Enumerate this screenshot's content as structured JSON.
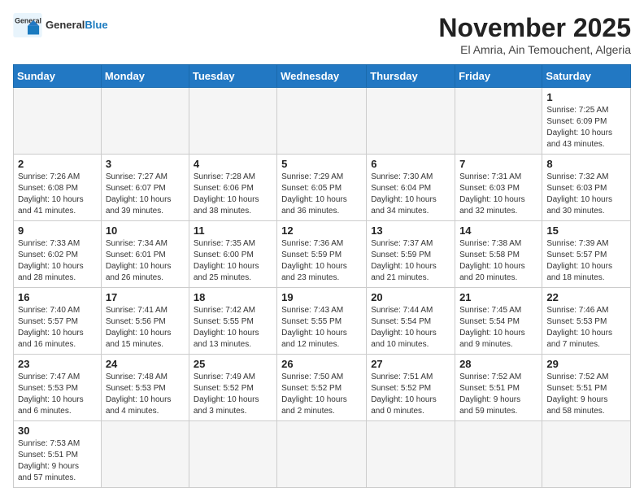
{
  "logo": {
    "text_general": "General",
    "text_blue": "Blue"
  },
  "title": {
    "month_year": "November 2025",
    "location": "El Amria, Ain Temouchent, Algeria"
  },
  "headers": [
    "Sunday",
    "Monday",
    "Tuesday",
    "Wednesday",
    "Thursday",
    "Friday",
    "Saturday"
  ],
  "days": [
    {
      "num": "",
      "info": ""
    },
    {
      "num": "",
      "info": ""
    },
    {
      "num": "",
      "info": ""
    },
    {
      "num": "",
      "info": ""
    },
    {
      "num": "",
      "info": ""
    },
    {
      "num": "",
      "info": ""
    },
    {
      "num": "1",
      "info": "Sunrise: 7:25 AM\nSunset: 6:09 PM\nDaylight: 10 hours\nand 43 minutes."
    },
    {
      "num": "2",
      "info": "Sunrise: 7:26 AM\nSunset: 6:08 PM\nDaylight: 10 hours\nand 41 minutes."
    },
    {
      "num": "3",
      "info": "Sunrise: 7:27 AM\nSunset: 6:07 PM\nDaylight: 10 hours\nand 39 minutes."
    },
    {
      "num": "4",
      "info": "Sunrise: 7:28 AM\nSunset: 6:06 PM\nDaylight: 10 hours\nand 38 minutes."
    },
    {
      "num": "5",
      "info": "Sunrise: 7:29 AM\nSunset: 6:05 PM\nDaylight: 10 hours\nand 36 minutes."
    },
    {
      "num": "6",
      "info": "Sunrise: 7:30 AM\nSunset: 6:04 PM\nDaylight: 10 hours\nand 34 minutes."
    },
    {
      "num": "7",
      "info": "Sunrise: 7:31 AM\nSunset: 6:03 PM\nDaylight: 10 hours\nand 32 minutes."
    },
    {
      "num": "8",
      "info": "Sunrise: 7:32 AM\nSunset: 6:03 PM\nDaylight: 10 hours\nand 30 minutes."
    },
    {
      "num": "9",
      "info": "Sunrise: 7:33 AM\nSunset: 6:02 PM\nDaylight: 10 hours\nand 28 minutes."
    },
    {
      "num": "10",
      "info": "Sunrise: 7:34 AM\nSunset: 6:01 PM\nDaylight: 10 hours\nand 26 minutes."
    },
    {
      "num": "11",
      "info": "Sunrise: 7:35 AM\nSunset: 6:00 PM\nDaylight: 10 hours\nand 25 minutes."
    },
    {
      "num": "12",
      "info": "Sunrise: 7:36 AM\nSunset: 5:59 PM\nDaylight: 10 hours\nand 23 minutes."
    },
    {
      "num": "13",
      "info": "Sunrise: 7:37 AM\nSunset: 5:59 PM\nDaylight: 10 hours\nand 21 minutes."
    },
    {
      "num": "14",
      "info": "Sunrise: 7:38 AM\nSunset: 5:58 PM\nDaylight: 10 hours\nand 20 minutes."
    },
    {
      "num": "15",
      "info": "Sunrise: 7:39 AM\nSunset: 5:57 PM\nDaylight: 10 hours\nand 18 minutes."
    },
    {
      "num": "16",
      "info": "Sunrise: 7:40 AM\nSunset: 5:57 PM\nDaylight: 10 hours\nand 16 minutes."
    },
    {
      "num": "17",
      "info": "Sunrise: 7:41 AM\nSunset: 5:56 PM\nDaylight: 10 hours\nand 15 minutes."
    },
    {
      "num": "18",
      "info": "Sunrise: 7:42 AM\nSunset: 5:55 PM\nDaylight: 10 hours\nand 13 minutes."
    },
    {
      "num": "19",
      "info": "Sunrise: 7:43 AM\nSunset: 5:55 PM\nDaylight: 10 hours\nand 12 minutes."
    },
    {
      "num": "20",
      "info": "Sunrise: 7:44 AM\nSunset: 5:54 PM\nDaylight: 10 hours\nand 10 minutes."
    },
    {
      "num": "21",
      "info": "Sunrise: 7:45 AM\nSunset: 5:54 PM\nDaylight: 10 hours\nand 9 minutes."
    },
    {
      "num": "22",
      "info": "Sunrise: 7:46 AM\nSunset: 5:53 PM\nDaylight: 10 hours\nand 7 minutes."
    },
    {
      "num": "23",
      "info": "Sunrise: 7:47 AM\nSunset: 5:53 PM\nDaylight: 10 hours\nand 6 minutes."
    },
    {
      "num": "24",
      "info": "Sunrise: 7:48 AM\nSunset: 5:53 PM\nDaylight: 10 hours\nand 4 minutes."
    },
    {
      "num": "25",
      "info": "Sunrise: 7:49 AM\nSunset: 5:52 PM\nDaylight: 10 hours\nand 3 minutes."
    },
    {
      "num": "26",
      "info": "Sunrise: 7:50 AM\nSunset: 5:52 PM\nDaylight: 10 hours\nand 2 minutes."
    },
    {
      "num": "27",
      "info": "Sunrise: 7:51 AM\nSunset: 5:52 PM\nDaylight: 10 hours\nand 0 minutes."
    },
    {
      "num": "28",
      "info": "Sunrise: 7:52 AM\nSunset: 5:51 PM\nDaylight: 9 hours\nand 59 minutes."
    },
    {
      "num": "29",
      "info": "Sunrise: 7:52 AM\nSunset: 5:51 PM\nDaylight: 9 hours\nand 58 minutes."
    },
    {
      "num": "30",
      "info": "Sunrise: 7:53 AM\nSunset: 5:51 PM\nDaylight: 9 hours\nand 57 minutes."
    },
    {
      "num": "",
      "info": ""
    },
    {
      "num": "",
      "info": ""
    },
    {
      "num": "",
      "info": ""
    },
    {
      "num": "",
      "info": ""
    },
    {
      "num": "",
      "info": ""
    },
    {
      "num": "",
      "info": ""
    }
  ]
}
